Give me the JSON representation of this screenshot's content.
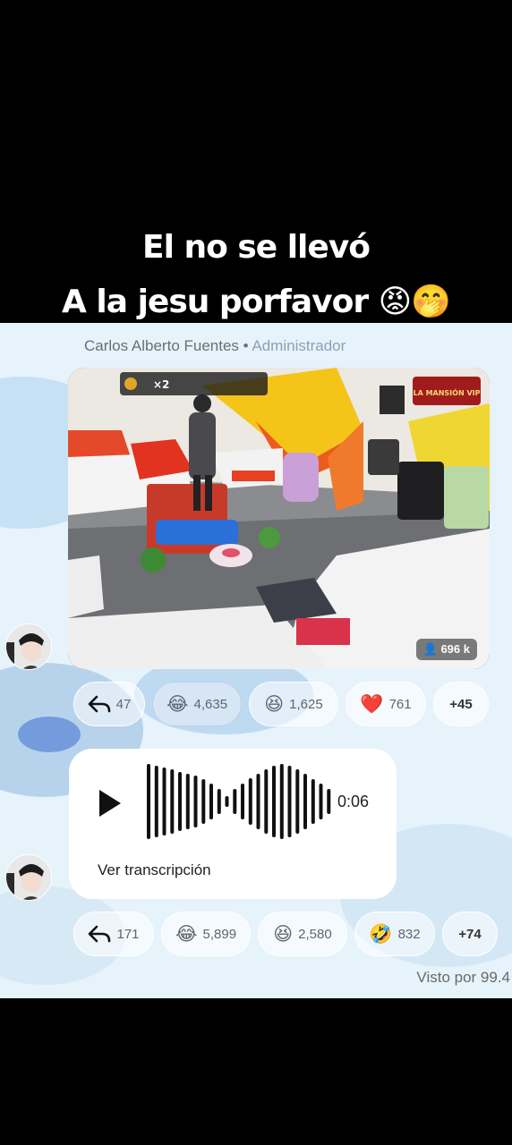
{
  "caption": {
    "line1": "El no se llevó",
    "line2": "A la jesu porfavor 😡🤭"
  },
  "post": {
    "sender_name": "Carlos Alberto Fuentes",
    "separator": " • ",
    "sender_role": "Administrador",
    "video": {
      "hud_multiplier": "×2",
      "logo_text": "LA MANSIÓN VIP",
      "viewer_count": "696 k"
    },
    "reactions": [
      {
        "icon": "reply-icon",
        "emoji": "",
        "count": "47",
        "selected": false
      },
      {
        "icon": "tears-of-joy-emoji",
        "emoji": "😂",
        "count": "4,635",
        "selected": true
      },
      {
        "icon": "grinning-squint-emoji",
        "emoji": "😆",
        "count": "1,625",
        "selected": false
      },
      {
        "icon": "red-heart-emoji",
        "emoji": "❤️",
        "count": "761",
        "selected": false
      },
      {
        "icon": "more-reactions",
        "emoji": "",
        "count": "+45",
        "selected": false
      }
    ]
  },
  "audio_message": {
    "duration": "0:06",
    "transcript_label": "Ver transcripción",
    "reactions": [
      {
        "icon": "reply-icon",
        "emoji": "",
        "count": "171"
      },
      {
        "icon": "tears-of-joy-emoji",
        "emoji": "😂",
        "count": "5,899"
      },
      {
        "icon": "grinning-squint-emoji",
        "emoji": "😆",
        "count": "2,580"
      },
      {
        "icon": "rolling-laughing-emoji",
        "emoji": "🤣",
        "count": "832"
      },
      {
        "icon": "more-reactions",
        "emoji": "",
        "count": "+74"
      }
    ]
  },
  "seen_by": "Visto por 99.4",
  "colors": {
    "chat_background": "#e6f3fb",
    "accent_red": "#e0252c"
  }
}
